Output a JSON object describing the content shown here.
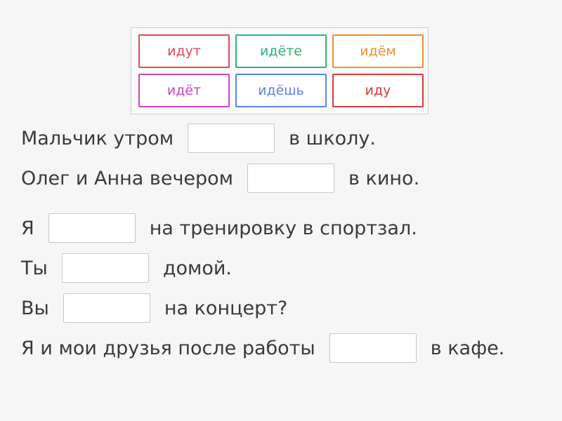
{
  "word_bank": {
    "chips": [
      {
        "label": "идут",
        "color": "#e14a55"
      },
      {
        "label": "идёте",
        "color": "#2eb37b"
      },
      {
        "label": "идём",
        "color": "#f0912e"
      },
      {
        "label": "идёт",
        "color": "#c846c6"
      },
      {
        "label": "идёшь",
        "color": "#5b86e0"
      },
      {
        "label": "иду",
        "color": "#d83a3a"
      }
    ]
  },
  "sentences": [
    {
      "before": "Мальчик утром",
      "after": "в школу."
    },
    {
      "before": "Олег и Анна вечером",
      "after": "в кино."
    },
    {
      "before": "Я",
      "after": "на тренировку в спортзал."
    },
    {
      "before": "Ты",
      "after": "домой."
    },
    {
      "before": "Вы",
      "after": "на концерт?"
    },
    {
      "before": "Я и мои друзья после работы",
      "after": "в кафе."
    }
  ]
}
